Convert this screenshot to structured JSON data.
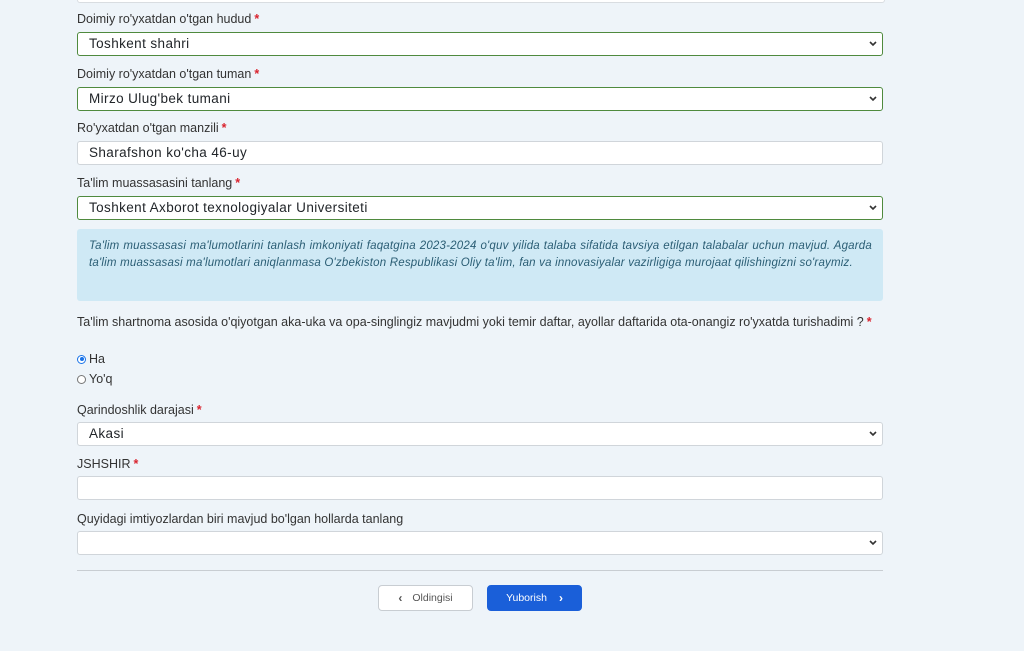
{
  "fields": {
    "region": {
      "label": "Doimiy ro'yxatdan o'tgan hudud",
      "value": "Toshkent shahri"
    },
    "district": {
      "label": "Doimiy ro'yxatdan o'tgan tuman",
      "value": "Mirzo Ulug'bek tumani"
    },
    "address": {
      "label": "Ro'yxatdan o'tgan manzili",
      "value": "Sharafshon ko'cha 46-uy"
    },
    "institution": {
      "label": "Ta'lim muassasasini tanlang",
      "value": "Toshkent Axborot texnologiyalar Universiteti"
    },
    "kinship": {
      "label": "Qarindoshlik darajasi",
      "value": "Akasi"
    },
    "jshshir": {
      "label": "JSHSHIR",
      "value": ""
    },
    "privilege": {
      "label": "Quyidagi imtiyozlardan biri mavjud bo'lgan hollarda tanlang",
      "value": ""
    }
  },
  "required_mark": "*",
  "info_text": "Ta'lim muassasasi ma'lumotlarini tanlash imkoniyati faqatgina 2023-2024 o'quv yilida talaba sifatida tavsiya etilgan talabalar uchun mavjud. Agarda ta'lim muassasasi ma'lumotlari aniqlanmasa O'zbekiston Respublikasi Oliy ta'lim, fan va innovasiyalar vazirligiga murojaat qilishingizni so'raymiz.",
  "question": {
    "text": "Ta'lim shartnoma asosida o'qiyotgan aka-uka va opa-singlingiz mavjudmi yoki temir daftar, ayollar daftarida ota-onangiz ro'yxatda turishadimi ?",
    "options": [
      {
        "label": "Ha",
        "selected": true
      },
      {
        "label": "Yo'q",
        "selected": false
      }
    ]
  },
  "buttons": {
    "prev_label": "Oldingisi",
    "next_label": "Yuborish"
  },
  "colors": {
    "primary": "#1a5fd9",
    "required": "#d9232e",
    "info_bg": "#cfe9f5",
    "valid_border": "#4f8a3e"
  }
}
